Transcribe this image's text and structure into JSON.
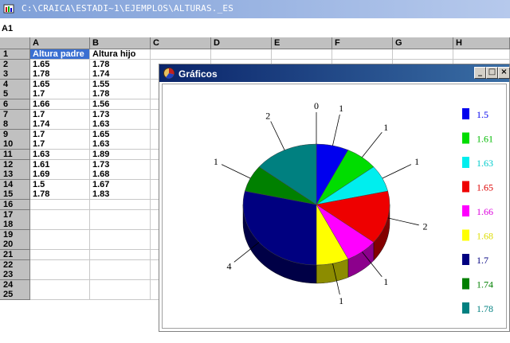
{
  "app": {
    "title": "C:\\CRAICA\\ESTADI~1\\EJEMPLOS\\ALTURAS._ES"
  },
  "formula_bar": {
    "cell_ref": "A1"
  },
  "sheet": {
    "columns": [
      "A",
      "B",
      "C",
      "D",
      "E",
      "F",
      "G",
      "H"
    ],
    "rows": [
      "1",
      "2",
      "3",
      "4",
      "5",
      "6",
      "7",
      "8",
      "9",
      "10",
      "11",
      "12",
      "13",
      "14",
      "15",
      "16",
      "17",
      "18",
      "19",
      "20",
      "21",
      "22",
      "23",
      "24",
      "25"
    ],
    "data": [
      [
        "Altura padre",
        "Altura hijo"
      ],
      [
        "1.65",
        "1.78"
      ],
      [
        "1.78",
        "1.74"
      ],
      [
        "1.65",
        "1.55"
      ],
      [
        "1.7",
        "1.78"
      ],
      [
        "1.66",
        "1.56"
      ],
      [
        "1.7",
        "1.73"
      ],
      [
        "1.74",
        "1.63"
      ],
      [
        "1.7",
        "1.65"
      ],
      [
        "1.7",
        "1.63"
      ],
      [
        "1.63",
        "1.89"
      ],
      [
        "1.61",
        "1.73"
      ],
      [
        "1.69",
        "1.68"
      ],
      [
        "1.5",
        "1.67"
      ],
      [
        "1.78",
        "1.83"
      ]
    ]
  },
  "chart_window": {
    "title": "Gráficos",
    "minimize": "_",
    "maximize": "□",
    "close": "×"
  },
  "chart_data": {
    "type": "pie",
    "categories": [
      "1.5",
      "1.61",
      "1.63",
      "1.65",
      "1.66",
      "1.68",
      "1.7",
      "1.74",
      "1.78"
    ],
    "values": [
      1,
      1,
      1,
      2,
      1,
      1,
      4,
      1,
      2
    ],
    "slice_labels": [
      "1",
      "1",
      "1",
      "2",
      "1",
      "1",
      "4",
      "1",
      "2"
    ],
    "extra_label": "0",
    "colors": [
      "#0000ee",
      "#00dd00",
      "#00eeee",
      "#ee0000",
      "#ff00ff",
      "#ffff00",
      "#000080",
      "#008000",
      "#008080"
    ],
    "legend_text_colors": [
      "#0000ee",
      "#00bb00",
      "#00cccc",
      "#dd0000",
      "#dd00dd",
      "#dddd00",
      "#000080",
      "#008000",
      "#008080"
    ],
    "legend": "right",
    "style": "3d"
  }
}
